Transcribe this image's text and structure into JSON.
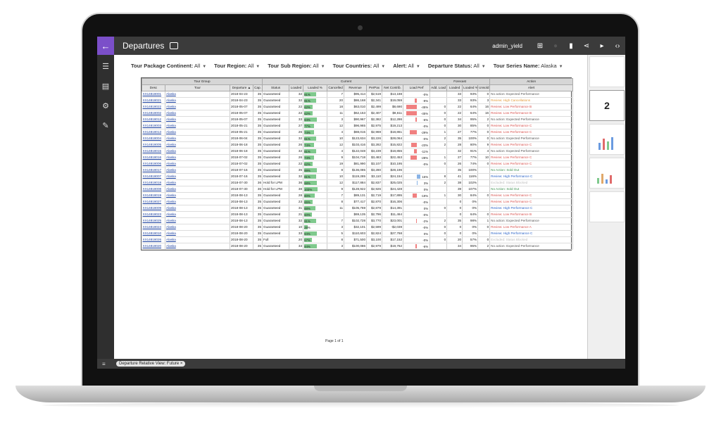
{
  "app": {
    "title": "Departures",
    "user": "admin_yield",
    "bottom_filter_chip": "Departure Relative View: Future ×",
    "thumb2_label": "2",
    "page_indicator": "Page 1 of 1"
  },
  "filters": [
    {
      "label": "Tour Package Continent:",
      "value": "All"
    },
    {
      "label": "Tour Region:",
      "value": "All"
    },
    {
      "label": "Tour Sub Region:",
      "value": "All"
    },
    {
      "label": "Tour Countries:",
      "value": "All"
    },
    {
      "label": "Alert:",
      "value": "All"
    },
    {
      "label": "Departure Status:",
      "value": "All"
    },
    {
      "label": "Tour Series Name:",
      "value": "Alaska"
    }
  ],
  "colors": {
    "accent": "#7b4fc9",
    "bar_green": "#7fc98d",
    "neg": "#f08080",
    "pos_blue": "#8ab4e6"
  },
  "table": {
    "group_headers": [
      "Tour Group",
      "Current",
      "Forecast",
      "Action"
    ],
    "headers": [
      "Desc",
      "Tour",
      "Departure ▲",
      "Cap.",
      "Status",
      "Loaded",
      "Loaded %",
      "Cancelled",
      "Revenue",
      "PerPax",
      "Net Contrib.",
      "Load Perf",
      "Add. Load",
      "Loaded",
      "Loaded %",
      "Unsold",
      "Alert"
    ],
    "rows": [
      [
        "XX14818001",
        "Alaska",
        "2018-04-23",
        "35",
        "Guaranteed",
        "32",
        "91%",
        "7",
        "$95,414",
        "$2,519",
        "$13,188",
        "-0%",
        "",
        "33",
        "93%",
        "0",
        "No action: Expected Performance",
        91,
        0
      ],
      [
        "XX14818021",
        "Alaska",
        "2018-04-23",
        "35",
        "Guaranteed",
        "32",
        "91%",
        "20",
        "$86,168",
        "$2,341",
        "$19,059",
        "-9%",
        "",
        "33",
        "93%",
        "3",
        "Review: High Cancellations",
        91,
        -9
      ],
      [
        "XX14818022",
        "Alaska",
        "2018-05-07",
        "35",
        "Guaranteed",
        "22",
        "62%",
        "18",
        "$63,010",
        "$2,499",
        "$8,690",
        "-45%",
        "0",
        "22",
        "64%",
        "16",
        "Review: Low Performance B",
        62,
        -45
      ],
      [
        "XX14818002",
        "Alaska",
        "2018-05-07",
        "35",
        "Guaranteed",
        "22",
        "62%",
        "11",
        "$62,153",
        "$2,407",
        "$8,611",
        "-45%",
        "0",
        "22",
        "64%",
        "16",
        "Review: Low Performance B",
        62,
        -45
      ],
      [
        "XX14818012",
        "Alaska",
        "2018-05-07",
        "35",
        "Guaranteed",
        "33",
        "94%",
        "3",
        "$90,967",
        "$2,382",
        "$12,286",
        "-6%",
        "0",
        "34",
        "95%",
        "2",
        "No action: Expected Performance",
        94,
        -6
      ],
      [
        "XX14818003",
        "Alaska",
        "2018-05-21",
        "35",
        "Guaranteed",
        "27",
        "77%",
        "12",
        "$96,965",
        "$2,975",
        "$19,213",
        "-0%",
        "0",
        "30",
        "85%",
        "0",
        "Review: Low Performance C",
        77,
        0
      ],
      [
        "XX14818013",
        "Alaska",
        "2018-05-21",
        "35",
        "Guaranteed",
        "26",
        "74%",
        "4",
        "$88,015",
        "$2,969",
        "$18,861",
        "-29%",
        "1",
        "27",
        "77%",
        "0",
        "Review: Low Performance C",
        74,
        -29
      ],
      [
        "XX14818004",
        "Alaska",
        "2018-06-04",
        "35",
        "Guaranteed",
        "32",
        "91%",
        "10",
        "$123,634",
        "$3,226",
        "$28,064",
        "-0%",
        "2",
        "35",
        "100%",
        "0",
        "No action: Expected Performance",
        91,
        0
      ],
      [
        "XX14818005",
        "Alaska",
        "2018-06-18",
        "35",
        "Guaranteed",
        "26",
        "74%",
        "12",
        "$103,416",
        "$3,282",
        "$15,822",
        "-23%",
        "2",
        "28",
        "80%",
        "9",
        "Review: Low Performance C",
        74,
        -23
      ],
      [
        "XX14818015",
        "Alaska",
        "2018-06-18",
        "35",
        "Guaranteed",
        "32",
        "91%",
        "4",
        "$122,048",
        "$3,239",
        "$18,855",
        "-11%",
        "",
        "32",
        "91%",
        "4",
        "No action: Expected Performance",
        91,
        -11
      ],
      [
        "XX14818016",
        "Alaska",
        "2018-07-02",
        "35",
        "Guaranteed",
        "26",
        "74%",
        "9",
        "$104,718",
        "$3,483",
        "$22,453",
        "-28%",
        "1",
        "27",
        "77%",
        "10",
        "Review: Low Performance C",
        74,
        -28
      ],
      [
        "XX14818006",
        "Alaska",
        "2018-07-02",
        "35",
        "Guaranteed",
        "22",
        "62%",
        "19",
        "$81,990",
        "$3,107",
        "$10,195",
        "-0%",
        "0",
        "26",
        "74%",
        "0",
        "Review: Low Performance C",
        62,
        0
      ],
      [
        "XX14818017",
        "Alaska",
        "2018-07-16",
        "35",
        "Guaranteed",
        "35",
        "99%",
        "8",
        "$136,085",
        "$3,280",
        "$28,196",
        "",
        "",
        "35",
        "100%",
        "",
        "No Action: Sold Out",
        99,
        0
      ],
      [
        "XX14818007",
        "Alaska",
        "2018-07-16",
        "35",
        "Guaranteed",
        "32",
        "91%",
        "10",
        "$119,285",
        "$3,110",
        "$24,154",
        "16%",
        "8",
        "41",
        "116%",
        "",
        "Review: High Performance C",
        91,
        16
      ],
      [
        "XX14818018",
        "Alaska",
        "2018-07-30",
        "36",
        "Hold for LPM",
        "36",
        "98%",
        "12",
        "$117,884",
        "$2,837",
        "$25,025",
        "3%",
        "2",
        "38",
        "102%",
        "",
        "Excluded: Status Blocked",
        98,
        3
      ],
      [
        "XX14818008",
        "Alaska",
        "2018-07-30",
        "36",
        "Hold for LPM",
        "38",
        "103%",
        "9",
        "$128,922",
        "$2,926",
        "$24,428",
        "0%",
        "",
        "39",
        "107%",
        "",
        "No Action: Sold Out",
        100,
        0
      ],
      [
        "XX14818019",
        "Alaska",
        "2018-08-13",
        "35",
        "Guaranteed",
        "28",
        "80%",
        "7",
        "$89,131",
        "$2,719",
        "$17,895",
        "-19%",
        "1",
        "30",
        "84%",
        "0",
        "Review: Low Performance C",
        80,
        -19
      ],
      [
        "XX14818027",
        "Alaska",
        "2018-08-13",
        "35",
        "Guaranteed",
        "23",
        "65%",
        "8",
        "$77,417",
        "$2,870",
        "$16,306",
        "-0%",
        "",
        "0",
        "0%",
        "",
        "Review: Low Performance C",
        65,
        0
      ],
      [
        "XX14818009",
        "Alaska",
        "2018-08-13",
        "35",
        "Guaranteed",
        "31",
        "88%",
        "11",
        "$105,769",
        "$2,879",
        "$14,391",
        "0%",
        "0",
        "0",
        "0%",
        "",
        "Review: High Performance C",
        88,
        0
      ],
      [
        "XX14818023",
        "Alaska",
        "2018-08-13",
        "35",
        "Guaranteed",
        "21",
        "60%",
        "",
        "$69,135",
        "$2,796",
        "$11,464",
        "-0%",
        "",
        "0",
        "64%",
        "0",
        "Review: Low Performance B",
        60,
        0
      ],
      [
        "XX14818025",
        "Alaska",
        "2018-08-13",
        "35",
        "Guaranteed",
        "32",
        "91%",
        "7",
        "$102,728",
        "$3,770",
        "$23,001",
        "-2%",
        "2",
        "35",
        "98%",
        "1",
        "No action: Expected Performance",
        91,
        -2
      ],
      [
        "XX14818024",
        "Alaska",
        "2018-08-20",
        "35",
        "Guaranteed",
        "10",
        "28%",
        "3",
        "$32,101",
        "$2,599",
        "-$2,039",
        "-0%",
        "0",
        "0",
        "0%",
        "0",
        "Review: Low Performance A",
        28,
        0
      ],
      [
        "XX14818010",
        "Alaska",
        "2018-08-20",
        "35",
        "Guaranteed",
        "33",
        "94%",
        "5",
        "$110,603",
        "$2,824",
        "$27,768",
        "0%",
        "0",
        "0",
        "0%",
        "",
        "Review: High Performance C",
        94,
        0
      ],
      [
        "XX14818026",
        "Alaska",
        "2018-08-20",
        "35",
        "Full",
        "20",
        "57%",
        "8",
        "$71,500",
        "$3,100",
        "$17,152",
        "-0%",
        "0",
        "20",
        "57%",
        "0",
        "Excluded: Status Blocked",
        57,
        0
      ],
      [
        "XX14818020",
        "Alaska",
        "2018-08-20",
        "35",
        "Guaranteed",
        "33",
        "94%",
        "3",
        "$100,086",
        "$2,979",
        "$19,762",
        "-6%",
        "",
        "34",
        "95%",
        "2",
        "No action: Expected Performance",
        94,
        -6
      ]
    ]
  }
}
